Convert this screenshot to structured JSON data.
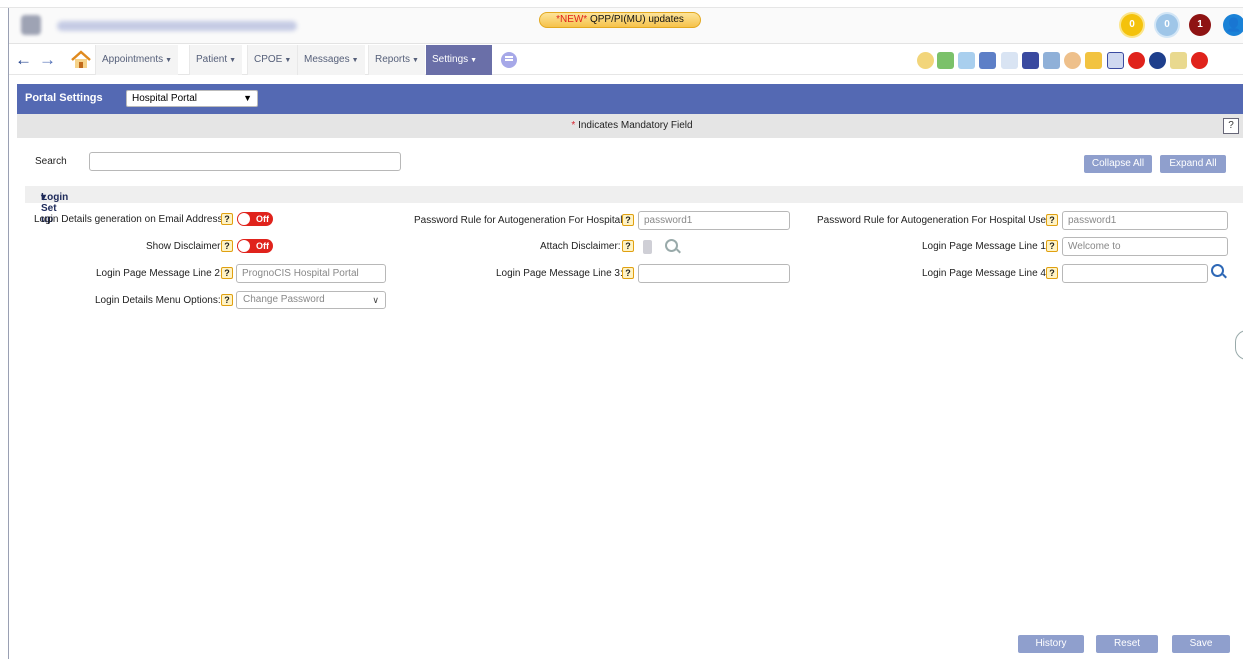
{
  "notice": {
    "new_tag": "*NEW*",
    "text": "QPP/PI(MU) updates"
  },
  "badges": [
    "0",
    "0",
    "1"
  ],
  "nav": {
    "menus": [
      "Appointments",
      "Patient",
      "CPOE",
      "Messages",
      "Reports",
      "Settings"
    ],
    "active": "Settings"
  },
  "portal": {
    "title": "Portal Settings",
    "selected": "Hospital Portal",
    "mandatory_star": "*",
    "mandatory_text": "Indicates Mandatory Field",
    "help_label": "?"
  },
  "search": {
    "label": "Search",
    "value": ""
  },
  "buttons": {
    "collapse_all": "Collapse All",
    "expand_all": "Expand All",
    "history": "History",
    "reset": "Reset",
    "save": "Save"
  },
  "section": {
    "title": "Login Set up",
    "caret": "▾"
  },
  "fields": {
    "login_email": {
      "label": "Login Details generation on Email Address:",
      "state": "Off"
    },
    "show_disclaimer": {
      "label": "Show Disclaimer:",
      "state": "Off"
    },
    "line2": {
      "label": "Login Page Message Line 2:",
      "value": "PrognoCIS Hospital Portal"
    },
    "menu_options": {
      "label": "Login Details Menu Options:",
      "value": "Change Password"
    },
    "pw_hospital": {
      "label": "Password Rule for Autogeneration For Hospital:",
      "value": "password1"
    },
    "attach_disclaimer": {
      "label": "Attach Disclaimer:"
    },
    "line3": {
      "label": "Login Page Message Line 3:",
      "value": ""
    },
    "pw_hospital_user": {
      "label": "Password Rule for Autogeneration For Hospital User:",
      "value": "password1"
    },
    "line1": {
      "label": "Login Page Message Line 1:",
      "value": "Welcome to"
    },
    "line4": {
      "label": "Login Page Message Line 4:",
      "value": ""
    }
  },
  "side_handle": "⋮",
  "colors": {
    "header": "#5469b3",
    "button": "#8f9fcd",
    "toggle_off": "#e0231c",
    "nav_active": "#6a6fa8"
  }
}
